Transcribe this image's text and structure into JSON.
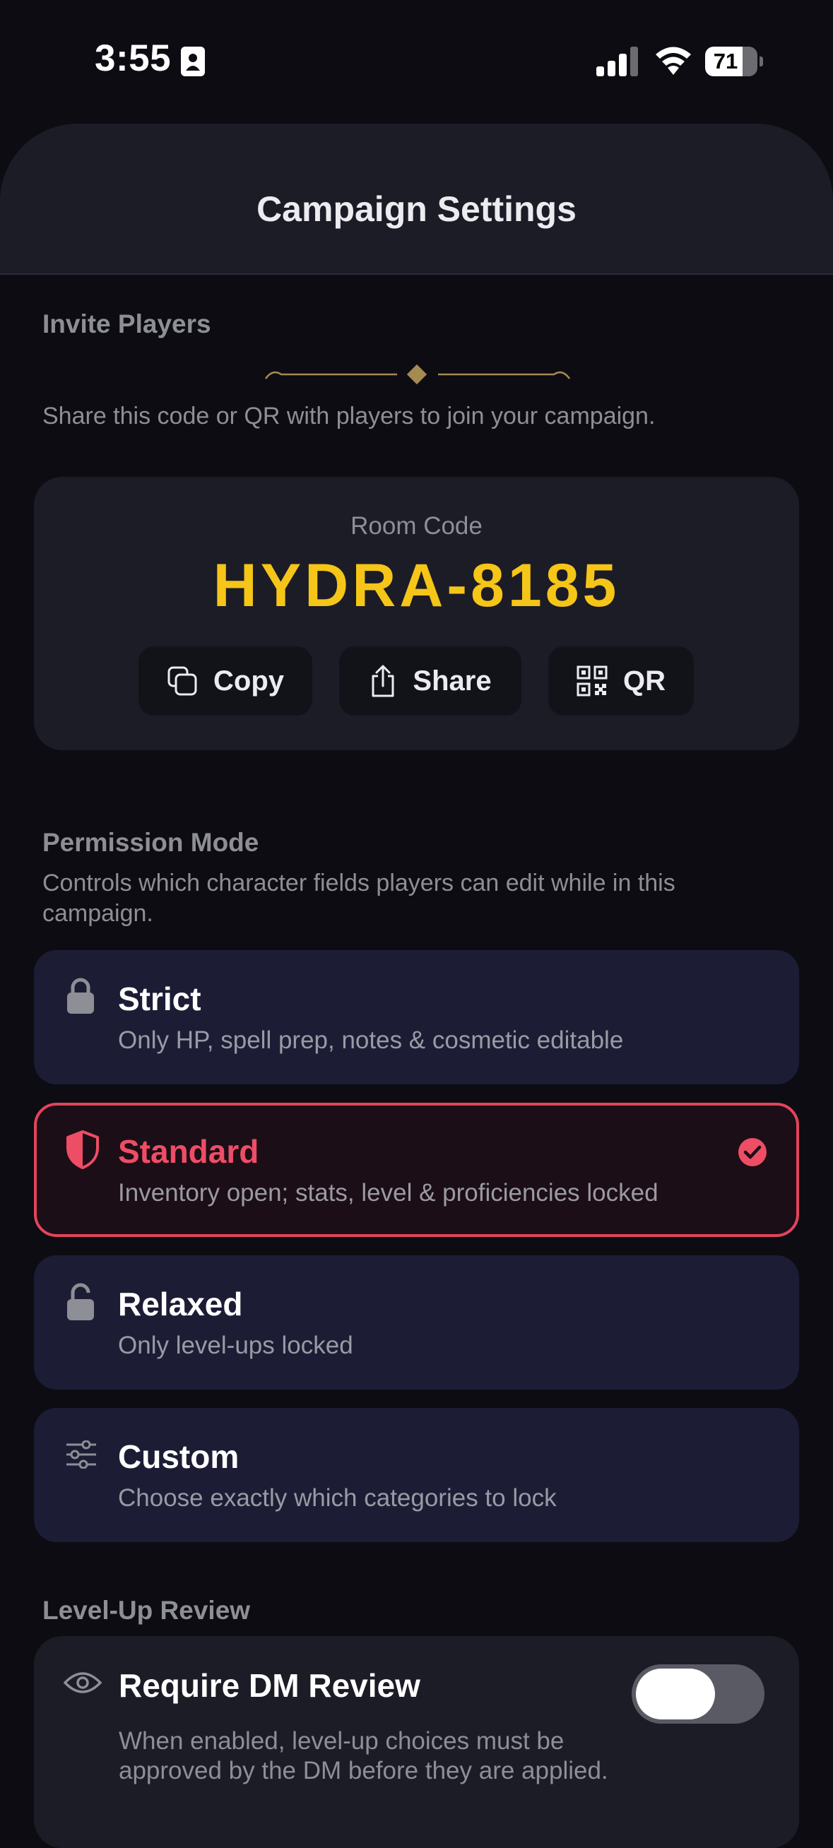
{
  "status_bar": {
    "time": "3:55",
    "battery": "71",
    "battery_level": 0.71
  },
  "header": {
    "title": "Campaign Settings"
  },
  "invite": {
    "section_label": "Invite Players",
    "description": "Share this code or QR with players to join your campaign.",
    "room_label": "Room Code",
    "room_code": "HYDRA-8185",
    "buttons": {
      "copy": "Copy",
      "share": "Share",
      "qr": "QR"
    }
  },
  "permission": {
    "section_label": "Permission Mode",
    "description": "Controls which character fields players can edit while in this campaign.",
    "selected": "Standard",
    "options": [
      {
        "title": "Strict",
        "subtitle": "Only HP, spell prep, notes & cosmetic editable",
        "icon": "lock-icon"
      },
      {
        "title": "Standard",
        "subtitle": "Inventory open; stats, level & proficiencies locked",
        "icon": "shield-icon"
      },
      {
        "title": "Relaxed",
        "subtitle": "Only level-ups locked",
        "icon": "unlock-icon"
      },
      {
        "title": "Custom",
        "subtitle": "Choose exactly which categories to lock",
        "icon": "sliders-icon"
      }
    ]
  },
  "level_up": {
    "section_label": "Level-Up Review",
    "toggle_title": "Require DM Review",
    "toggle_description": "When enabled, level-up choices must be approved by the DM before they are applied.",
    "toggle_on": false
  },
  "colors": {
    "accent_gold": "#f5c518",
    "accent_red": "#e2445c",
    "background": "#0c0c12",
    "card": "#1c1c27",
    "option_card": "#1c1d35"
  }
}
